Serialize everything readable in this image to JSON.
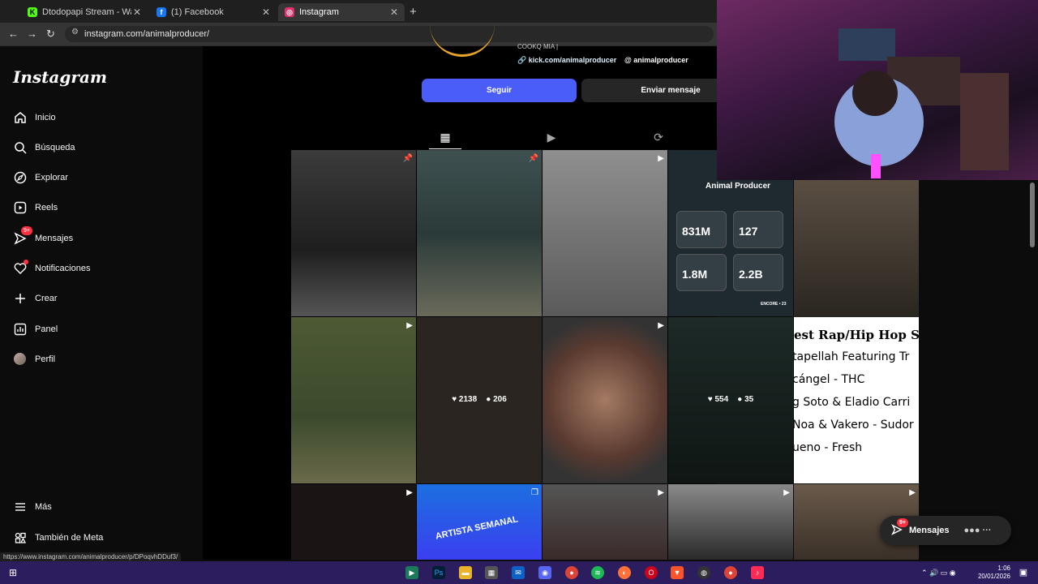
{
  "browser": {
    "tabs": [
      {
        "label": "Dtodopapi Stream - Watch Live",
        "favicon_color": "#53fc18",
        "favicon": "K"
      },
      {
        "label": "(1) Facebook",
        "favicon_color": "#1877f2",
        "favicon": "f"
      },
      {
        "label": "Instagram",
        "favicon_color": "#e1306c",
        "favicon": "◎"
      }
    ],
    "url": "instagram.com/animalproducer/",
    "status_url": "https://www.instagram.com/animalproducer/p/DPoqvhDDuf3/"
  },
  "sidebar": {
    "logo": "Instagram",
    "items": [
      {
        "label": "Inicio",
        "icon": "home-icon"
      },
      {
        "label": "Búsqueda",
        "icon": "search-icon"
      },
      {
        "label": "Explorar",
        "icon": "compass-icon"
      },
      {
        "label": "Reels",
        "icon": "reels-icon"
      },
      {
        "label": "Mensajes",
        "icon": "messenger-icon",
        "badge": "9+"
      },
      {
        "label": "Notificaciones",
        "icon": "heart-icon"
      },
      {
        "label": "Crear",
        "icon": "plus-icon"
      },
      {
        "label": "Panel",
        "icon": "chart-icon"
      },
      {
        "label": "Perfil",
        "icon": "avatar"
      }
    ],
    "more": "Más",
    "meta": "También de Meta"
  },
  "profile": {
    "bio_fragment": "COOKQ MIA |",
    "kick_link": "kick.com/animalproducer",
    "threads_link": "animalproducer",
    "follow_label": "Seguir",
    "message_label": "Enviar mensaje"
  },
  "posts": {
    "row2_stats": [
      {
        "likes": "2138",
        "comments": "206"
      },
      {
        "likes": "554",
        "comments": "35"
      }
    ],
    "stats_card": {
      "title": "Animal Producer",
      "followers": "831M",
      "credits": "127",
      "videos": "1.8M",
      "views": "2.2B",
      "footer": "ENCORE • 23"
    },
    "playlist": {
      "title": "est Rap/Hip Hop Sor",
      "lines": [
        "tapellah Featuring Tr",
        "cángel - THC",
        "g Soto & Eladio Carri",
        "Noa & Vakero - Sudor",
        "ueno - Fresh"
      ]
    },
    "artista_label": "ARTISTA SEMANAL"
  },
  "messages_pill": {
    "label": "Mensajes",
    "badge": "9+"
  },
  "taskbar": {
    "time": "1:06",
    "date": "20/01/2026"
  },
  "colors": {
    "accent": "#4a5df9",
    "badge": "#ff3040",
    "taskbar": "#2b1d5e"
  }
}
